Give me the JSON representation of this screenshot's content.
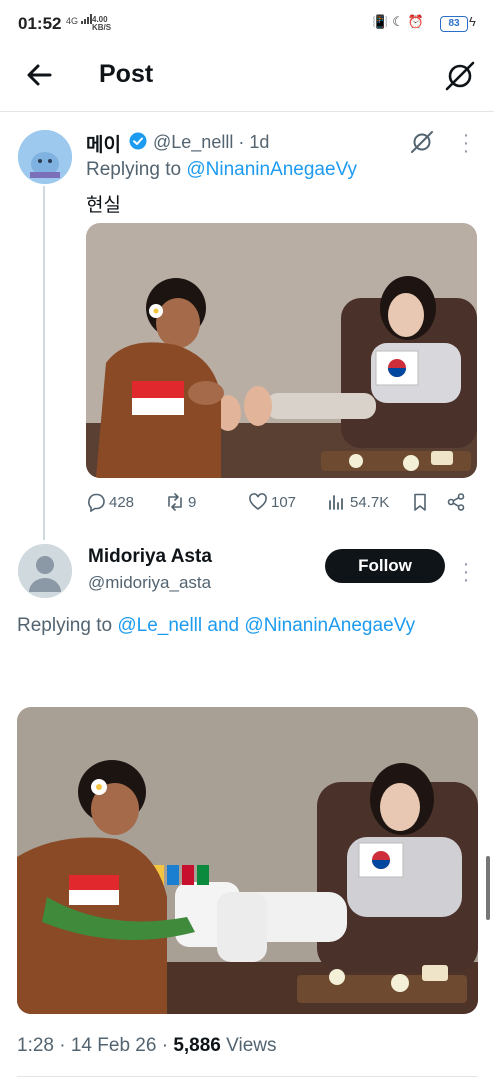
{
  "status_bar": {
    "time": "01:52",
    "network_label": "4G",
    "speed_value": "4.00",
    "speed_unit": "KB/S",
    "battery": "83"
  },
  "header": {
    "title": "Post"
  },
  "tweet1": {
    "author_name": "메이",
    "handle_time": "@Le_nelll · 1d",
    "replying_prefix": "Replying to ",
    "replying_handle": "@NinaninAnegaeVy",
    "text": "현실",
    "stats": {
      "replies": "428",
      "reposts": "9",
      "likes": "107",
      "views": "54.7K"
    }
  },
  "tweet2": {
    "author_name": "Midoriya Asta",
    "handle": "@midoriya_asta",
    "follow_label": "Follow",
    "replying_prefix": "Replying to ",
    "replying_handle1": "@Le_nelll",
    "replying_and": " and ",
    "replying_handle2": "@NinaninAnegaeVy",
    "meta_time": "1:28 · 14 Feb 26 · ",
    "meta_views_count": "5,886",
    "meta_views_label": " Views"
  },
  "colors": {
    "accent": "#1d9bf0",
    "text": "#0f1419",
    "muted": "#536471"
  },
  "icons": [
    "back-arrow-icon",
    "grok-icon",
    "verified-badge-icon",
    "more-icon",
    "reply-icon",
    "repost-icon",
    "like-icon",
    "views-icon",
    "bookmark-icon",
    "share-icon"
  ]
}
